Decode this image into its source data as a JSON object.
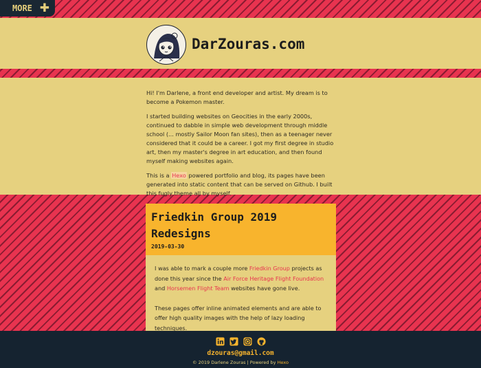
{
  "nav": {
    "more_label": "MORE",
    "toggle_icon": "plus-icon"
  },
  "header": {
    "site_title": "DarZouras.com",
    "avatar_icon": "avatar-illustration"
  },
  "intro": {
    "p1": "Hi! I'm Darlene, a front end developer and artist. My dream is to become a Pokemon master.",
    "p2": "I started building websites on Geocities in the early 2000s, continued to dabble in simple web development through middle school (... mostly Sailor Moon fan sites), then as a teenager never considered that it could be a career. I got my first degree in studio art, then my master's degree in art education, and then found myself making websites again.",
    "p3_before": "This is a ",
    "p3_link": "Hexo",
    "p3_after": " powered portfolio and blog, its pages have been generated into static content that can be served on Github. I built this fugly theme all by myself."
  },
  "post": {
    "title": "Friedkin Group 2019 Redesigns",
    "date": "2019-03-30",
    "p1_a": "I was able to mark a couple more ",
    "p1_link1": "Friedkin Group",
    "p1_b": " projects as done this year since the ",
    "p1_link2": "Air Force Heritage Flight Foundation",
    "p1_c": " and ",
    "p1_link3": "Horsemen Flight Team",
    "p1_d": " websites have gone live.",
    "p2": "These pages offer inline animated elements and are able to offer high quality images with the help of lazy loading techniques."
  },
  "footer": {
    "social_icons": [
      "linkedin-icon",
      "twitter-icon",
      "instagram-icon",
      "github-icon"
    ],
    "email": "dzouras@gmail.com",
    "copyright_before": "© 2019 Darlene Zouras | Powered by ",
    "copyright_link": "Hexo"
  },
  "colors": {
    "stripe_red": "#e8334f",
    "band_yellow": "#e6d17f",
    "card_orange": "#f8b42d",
    "footer_navy": "#152330"
  }
}
